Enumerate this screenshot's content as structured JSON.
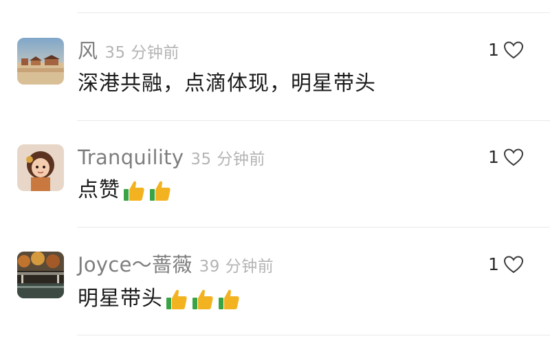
{
  "comments": [
    {
      "author": "风",
      "time": "35 分钟前",
      "text": "深港共融，点滴体现，明星带头",
      "likes": "1",
      "emoji_count": 0,
      "emoji": "thumbs-up-icon"
    },
    {
      "author": "Tranquility",
      "time": "35 分钟前",
      "text": "点赞",
      "likes": "1",
      "emoji_count": 2,
      "emoji": "thumbs-up-icon"
    },
    {
      "author": "Joyce～蔷薇",
      "time": "39 分钟前",
      "text": "明星带头",
      "likes": "1",
      "emoji_count": 3,
      "emoji": "thumbs-up-icon"
    }
  ],
  "icons": {
    "like": "heart-outline-icon",
    "reaction": "thumbs-up-icon"
  },
  "colors": {
    "name": "#7d7d7d",
    "time": "#b4b4b4",
    "text": "#1a1a1a",
    "divider": "#e9e9e9",
    "thumb": "#f3b320",
    "cuff": "#3aa345"
  }
}
